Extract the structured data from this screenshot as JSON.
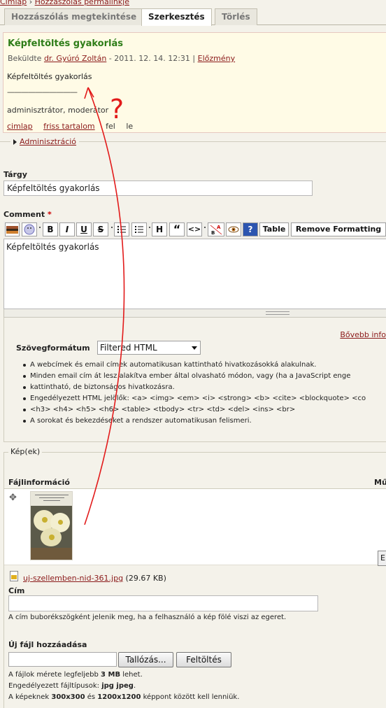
{
  "breadcrumb": {
    "home": "Címlap",
    "sep": "›",
    "current": "Hozzászólás permalinkje"
  },
  "tabs": [
    {
      "label": "Hozzászólás megtekintése"
    },
    {
      "label": "Szerkesztés"
    },
    {
      "label": "Törlés"
    }
  ],
  "preview": {
    "title": "Képfeltöltés gyakorlás",
    "meta_prefix": "Beküldte",
    "author": "dr. Gyúró Zoltán",
    "date": " - 2011. 12. 14. 12:31 | ",
    "prev_link": "Előzmény",
    "body": "Képfeltöltés gyakorlás",
    "separator": "——————————",
    "roles": "adminisztrátor, moderátor",
    "links": [
      "cimlap",
      "friss tartalom",
      "fel",
      "le"
    ],
    "annotation": "?"
  },
  "admin": {
    "label": "Adminisztráció"
  },
  "subject": {
    "label": "Tárgy",
    "value": "Képfeltöltés gyakorlás"
  },
  "comment": {
    "label": "Comment",
    "required_mark": "*",
    "value": "Képfeltöltés gyakorlás",
    "toolbar": {
      "bold": "B",
      "italic": "I",
      "underline": "U",
      "strike": "S",
      "heading": "H",
      "quote": "“",
      "code": "<>",
      "help": "?",
      "table": "Table",
      "remove_formatting": "Remove Formatting"
    }
  },
  "format": {
    "more_info": "Bővebb info",
    "label": "Szövegformátum",
    "selected": "Filtered HTML",
    "tips": [
      "A webcímek és email címek automatikusan kattintható hivatkozásokká alakulnak.",
      "Minden email cím át lesz alakítva ember által olvasható módon, vagy (ha a JavaScript enge",
      "kattintható, de biztonságos hivatkozásra.",
      "Engedélyezett HTML jelölők: <a> <img> <em> <i> <strong> <b> <cite> <blockquote> <co",
      "<h3> <h4> <h5> <h6> <table> <tbody> <tr> <td> <del> <ins> <br>",
      "A sorokat és bekezdéseket a rendszer automatikusan felismeri."
    ]
  },
  "images": {
    "legend": "Kép(ek)",
    "file_info_header": "Fájlinformáció",
    "ops_header": "Mű",
    "file_name": "uj-szellemben-nid-361.jpg",
    "file_size": " (29.67 KB)",
    "side_button": "E",
    "title_label": "Cím",
    "title_value": "",
    "title_hint": "A cím buborékszögként jelenik meg, ha a felhasználó a kép fölé viszi az egeret.",
    "new_file_label": "Új fájl hozzáadása",
    "browse_button": "Tallózás...",
    "upload_button": "Feltöltés",
    "limit_size_prefix": "A fájlok mérete legfeljebb ",
    "limit_size_value": "3 MB",
    "limit_size_suffix": " lehet.",
    "limit_types_prefix": "Engedélyezett fájltípusok: ",
    "limit_types_value": "jpg jpeg",
    "limit_types_suffix": ".",
    "limit_dims_prefix": "A képeknek ",
    "limit_dims_a": "300x300",
    "limit_dims_mid": " és ",
    "limit_dims_b": "1200x1200",
    "limit_dims_suffix": " képpont között kell lenniük."
  },
  "colors": {
    "accent_red": "#e21a1a",
    "title_green": "#2e7d18",
    "link": "#8b1a1a"
  },
  "icons": [
    "move-icon",
    "image-icon",
    "smiley-icon",
    "bold-icon",
    "italic-icon",
    "underline-icon",
    "strikethrough-icon",
    "unordered-list-icon",
    "ordered-list-icon",
    "heading-icon",
    "quote-icon",
    "code-icon",
    "text-color-icon",
    "preview-eye-icon",
    "help-icon",
    "file-icon"
  ]
}
